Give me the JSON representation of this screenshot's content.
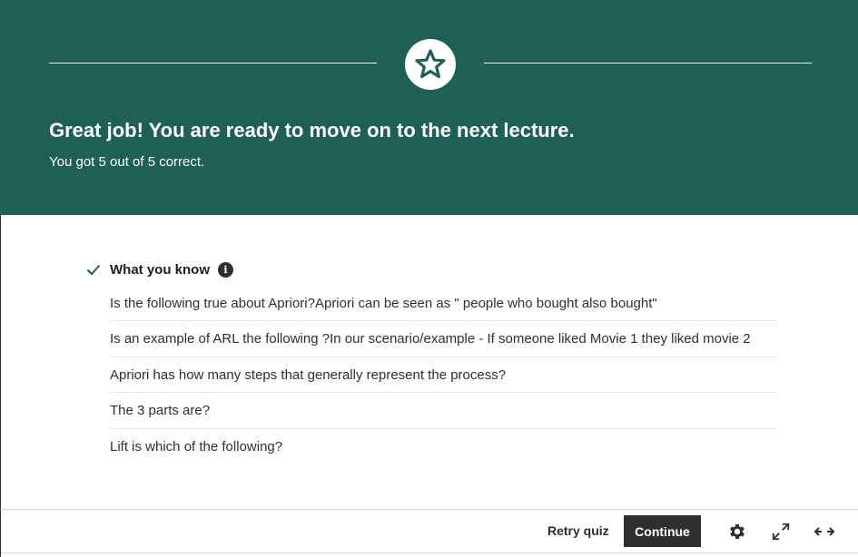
{
  "colors": {
    "banner": "#1e5f56",
    "accent_check": "#1e6055",
    "button_dark": "#2d2f31"
  },
  "banner": {
    "badge_icon": "star-icon",
    "headline": "Great job! You are ready to move on to the next lecture.",
    "score_text": "You got 5 out of 5 correct."
  },
  "results": {
    "section_icon": "check-icon",
    "section_title": "What you know",
    "info_icon": "info-icon",
    "info_glyph": "i",
    "questions": [
      "Is the following true about Apriori?Apriori can be seen as \" people who bought also bought\"",
      "Is an example of ARL the following ?In our scenario/example - If someone liked Movie 1 they liked movie 2",
      "Apriori has how many steps that generally represent the process?",
      "The 3 parts are?",
      "Lift is which of the following?"
    ]
  },
  "footer": {
    "retry_label": "Retry quiz",
    "continue_label": "Continue",
    "icons": [
      "gear-icon",
      "expand-icon",
      "expand-width-icon"
    ]
  }
}
